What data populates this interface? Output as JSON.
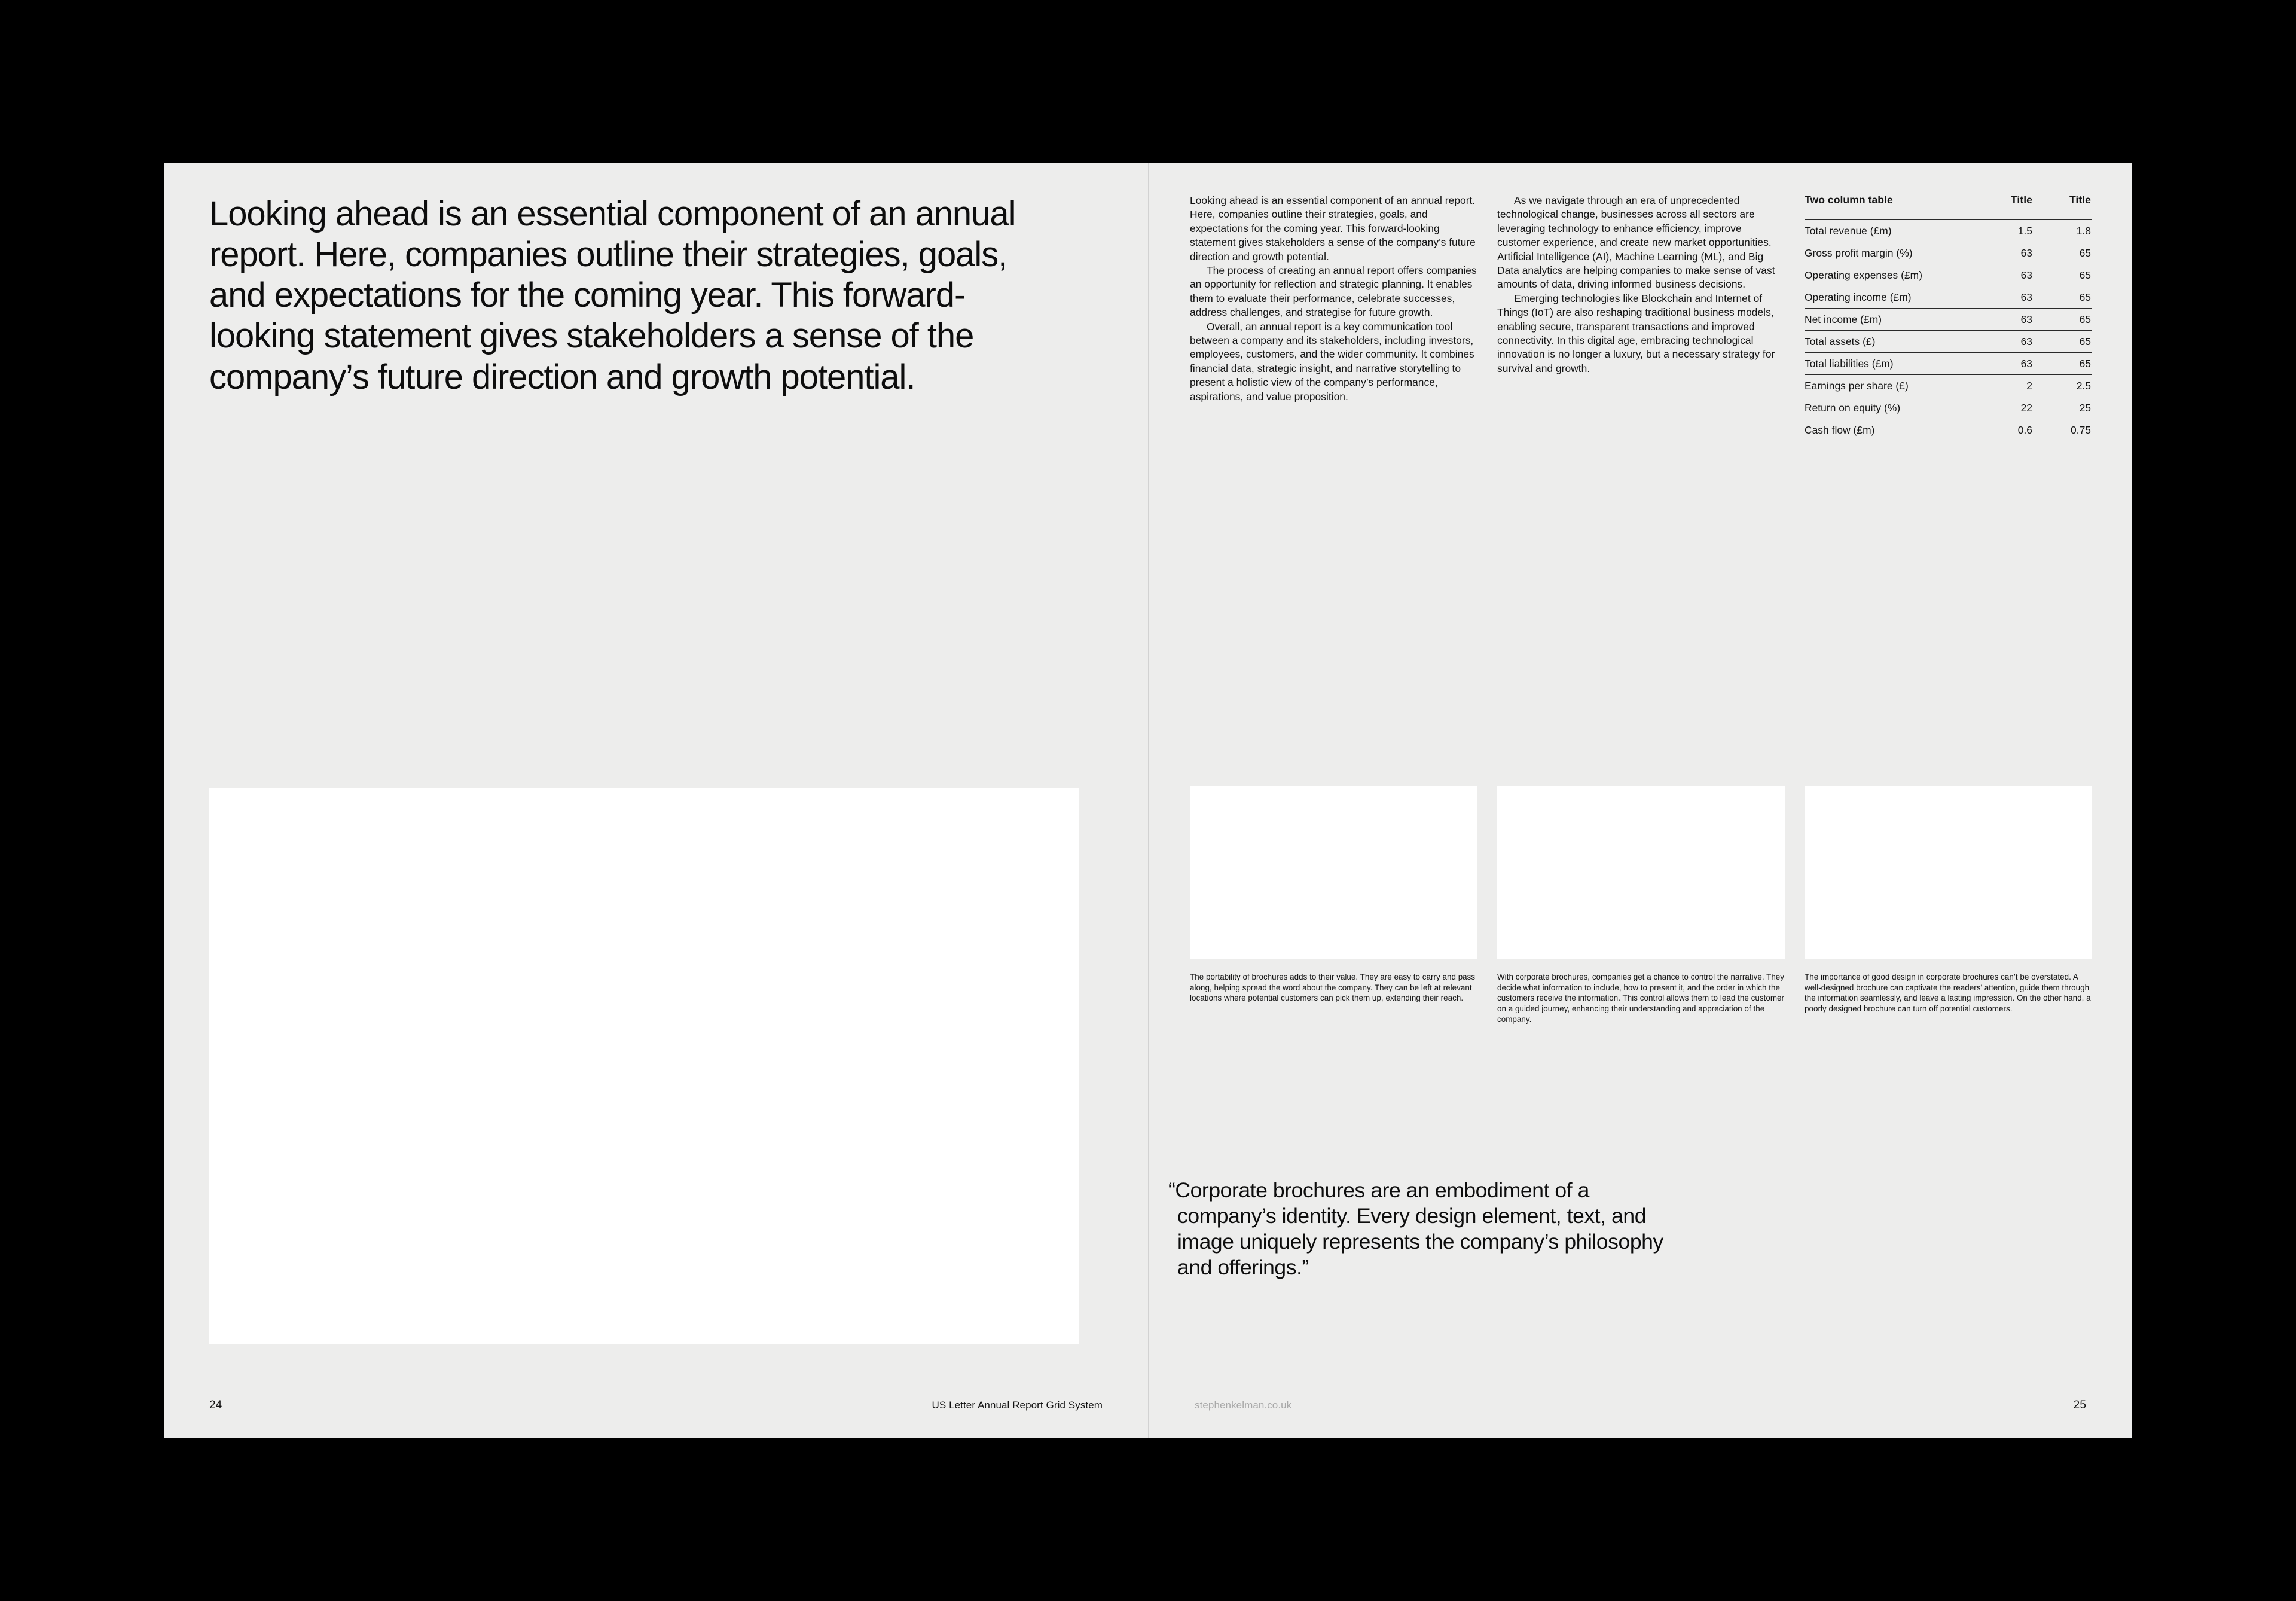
{
  "spread": {
    "page_bg": "#ededec",
    "canvas_bg": "#000000",
    "image_block_color": "#ffffff"
  },
  "left_page": {
    "headline": "Looking ahead is an essential component of an annual report. Here, companies outline their strategies, goals, and expectations for the coming year. This forward-looking statement gives stakeholders a sense of the company’s future direction and growth potential.",
    "footer": {
      "page_number": "24",
      "note": "US Letter Annual Report Grid System"
    }
  },
  "right_page": {
    "columns": [
      {
        "id": "col-1",
        "paragraphs": [
          "Looking ahead is an essential component of an annual report. Here, companies outline their strategies, goals, and expectations for the coming year. This forward-looking statement gives stakeholders a sense of the company’s future direction and growth potential.",
          "The process of creating an annual report offers companies an opportunity for reflection and strategic planning. It enables them to evaluate their performance, celebrate successes, address challenges, and strategise for future growth.",
          "Overall, an annual report is a key communication tool between a company and its stakeholders, including investors, employees, customers, and the wider community. It combines financial data, strategic insight, and narrative storytelling to present a holistic view of the company’s performance, aspirations, and value proposition."
        ]
      },
      {
        "id": "col-2",
        "paragraphs": [
          "As we navigate through an era of unprecedented technological change, businesses across all sectors are leveraging technology to enhance efficiency, improve customer experience, and create new market opportunities. Artificial Intelligence (AI), Machine Learning (ML), and Big Data analytics are helping companies to make sense of vast amounts of data, driving informed business decisions.",
          "Emerging technologies like Blockchain and Internet of Things (IoT) are also reshaping traditional business models, enabling secure, transparent transactions and improved connectivity. In this digital age, embracing technological innovation is no longer a luxury, but a necessary strategy for survival and growth."
        ]
      }
    ],
    "table": {
      "headers": [
        "Two column table",
        "Title",
        "Title"
      ],
      "rows": [
        [
          "Total revenue (£m)",
          "1.5",
          "1.8"
        ],
        [
          "Gross profit margin (%)",
          "63",
          "65"
        ],
        [
          "Operating expenses (£m)",
          "63",
          "65"
        ],
        [
          "Operating income (£m)",
          "63",
          "65"
        ],
        [
          "Net income (£m)",
          "63",
          "65"
        ],
        [
          "Total assets (£)",
          "63",
          "65"
        ],
        [
          "Total liabilities (£m)",
          "63",
          "65"
        ],
        [
          "Earnings per share (£)",
          "2",
          "2.5"
        ],
        [
          "Return on equity (%)",
          "22",
          "25"
        ],
        [
          "Cash flow (£m)",
          "0.6",
          "0.75"
        ]
      ]
    },
    "figures": [
      {
        "id": "figure-1",
        "caption": "The portability of brochures adds to their value. They are easy to carry and pass along, helping spread the word about the company. They can be left at relevant locations where potential customers can pick them up, extending their reach."
      },
      {
        "id": "figure-2",
        "caption": "With corporate brochures, companies get a chance to control the narrative. They decide what information to include, how to present it, and the order in which the customers receive the information. This control allows them to lead the customer on a guided journey, enhancing their understanding and appreciation of the company."
      },
      {
        "id": "figure-3",
        "caption": "The importance of good design in corporate brochures can’t be overstated. A well-designed brochure can captivate the readers’ attention, guide them through the information seamlessly, and leave a lasting impression. On the other hand, a poorly designed brochure can turn off potential customers."
      }
    ],
    "pull_quote": "“Corporate brochures are an embodiment of a company’s identity. Every design element, text, and image uniquely represents the company’s philosophy and offerings.”",
    "footer": {
      "page_number": "25",
      "note": "stephenkelman.co.uk"
    }
  }
}
